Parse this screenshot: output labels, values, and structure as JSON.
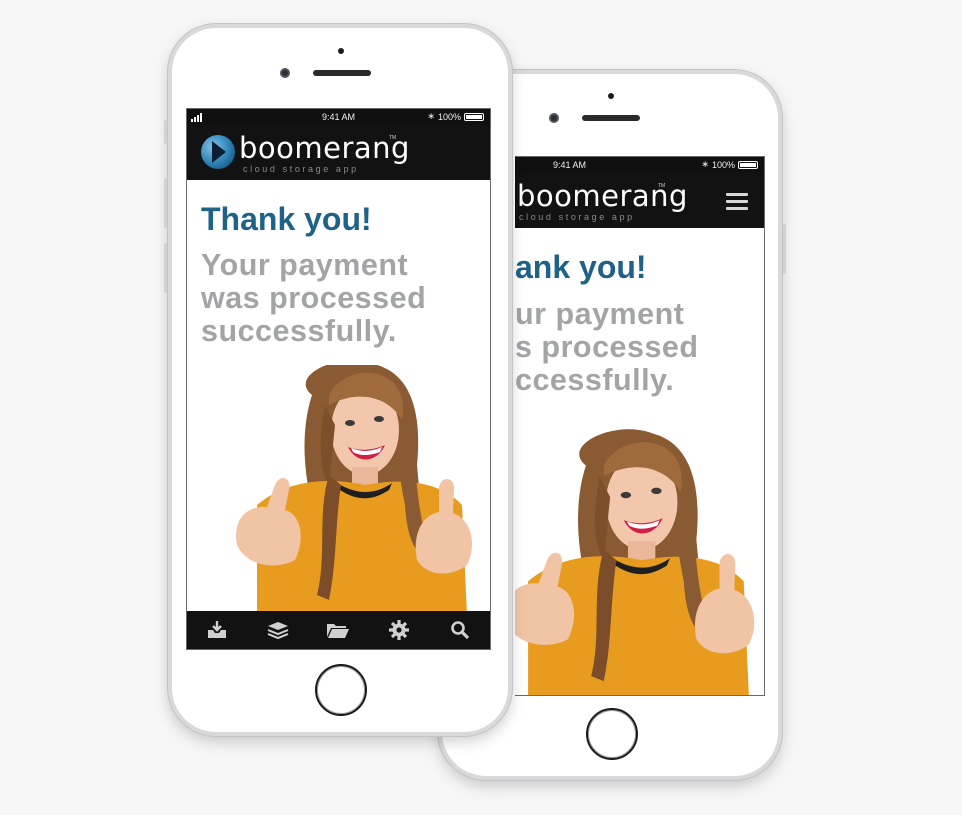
{
  "colors": {
    "heading": "#1e6288",
    "message": "#a3a4a6",
    "bar": "#121212",
    "background": "#f6f6f6"
  },
  "front": {
    "status": {
      "time": "9:41 AM",
      "battery": "100%"
    },
    "brand": {
      "name": "boomerang",
      "tagline": "cloud storage app",
      "tm": "TM"
    },
    "confirmation": {
      "title": "Thank you!",
      "line1": "Your payment",
      "line2": "was processed",
      "line3": "successfully."
    },
    "tabs": [
      {
        "icon": "download-tray-icon"
      },
      {
        "icon": "layers-icon"
      },
      {
        "icon": "folder-icon"
      },
      {
        "icon": "gear-icon"
      },
      {
        "icon": "search-icon"
      }
    ]
  },
  "back": {
    "status": {
      "time": "9:41 AM",
      "battery": "100%"
    },
    "brand": {
      "name": "boomerang",
      "tagline": "cloud storage app",
      "tm": "TM"
    },
    "confirmation": {
      "title": "ank you!",
      "line1": "ur payment",
      "line2": "s processed",
      "line3": "ccessfully."
    },
    "menu_icon": "hamburger-menu-icon"
  }
}
